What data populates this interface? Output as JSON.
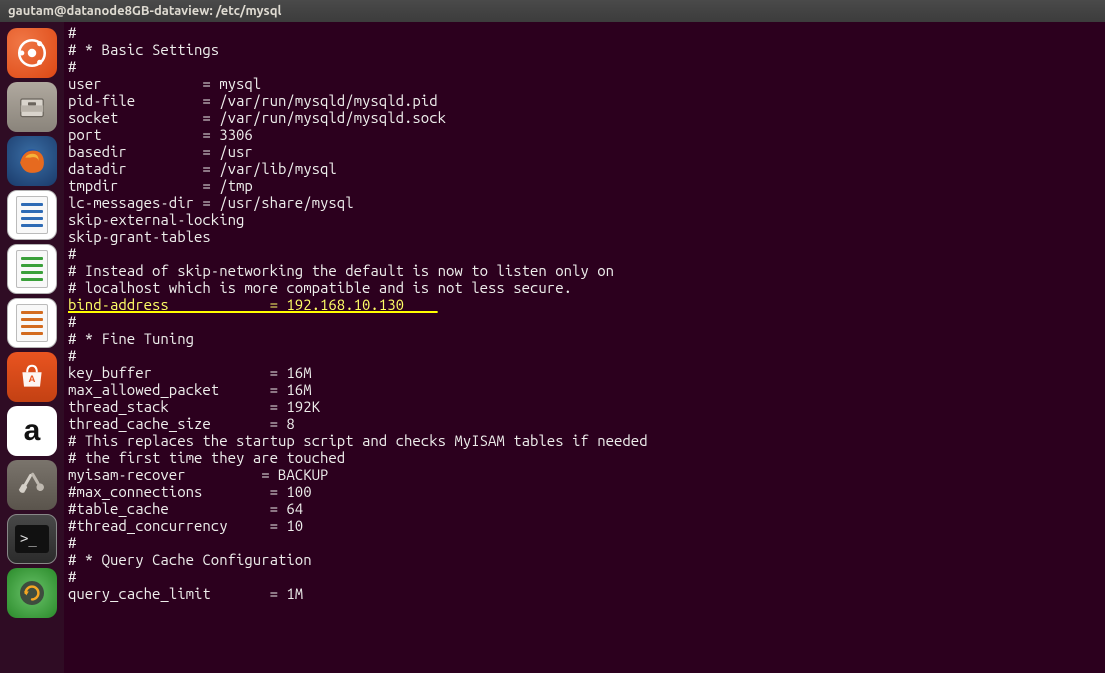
{
  "window": {
    "title": "gautam@datanode8GB-dataview: /etc/mysql"
  },
  "launcher": {
    "dash_label": "Dash",
    "files_label": "Files",
    "firefox_label": "Firefox",
    "writer_label": "LibreOffice Writer",
    "calc_label": "LibreOffice Calc",
    "impress_label": "LibreOffice Impress",
    "software_label": "Ubuntu Software",
    "amazon_label": "Amazon",
    "amazon_glyph": "a",
    "settings_label": "System Settings",
    "terminal_label": "Terminal",
    "terminal_prompt": ">_",
    "updater_label": "Software Updater"
  },
  "terminal": {
    "lines": [
      "#",
      "# * Basic Settings",
      "#",
      "user            = mysql",
      "pid-file        = /var/run/mysqld/mysqld.pid",
      "socket          = /var/run/mysqld/mysqld.sock",
      "port            = 3306",
      "basedir         = /usr",
      "datadir         = /var/lib/mysql",
      "tmpdir          = /tmp",
      "lc-messages-dir = /usr/share/mysql",
      "skip-external-locking",
      "skip-grant-tables",
      "#",
      "# Instead of skip-networking the default is now to listen only on",
      "# localhost which is more compatible and is not less secure."
    ],
    "highlight_line": "bind-address            = 192.168.10.130",
    "lines_after": [
      "#",
      "# * Fine Tuning",
      "#",
      "key_buffer              = 16M",
      "max_allowed_packet      = 16M",
      "thread_stack            = 192K",
      "thread_cache_size       = 8",
      "# This replaces the startup script and checks MyISAM tables if needed",
      "# the first time they are touched",
      "myisam-recover         = BACKUP",
      "#max_connections        = 100",
      "#table_cache            = 64",
      "#thread_concurrency     = 10",
      "#",
      "# * Query Cache Configuration",
      "#",
      "query_cache_limit       = 1M",
      ""
    ]
  }
}
